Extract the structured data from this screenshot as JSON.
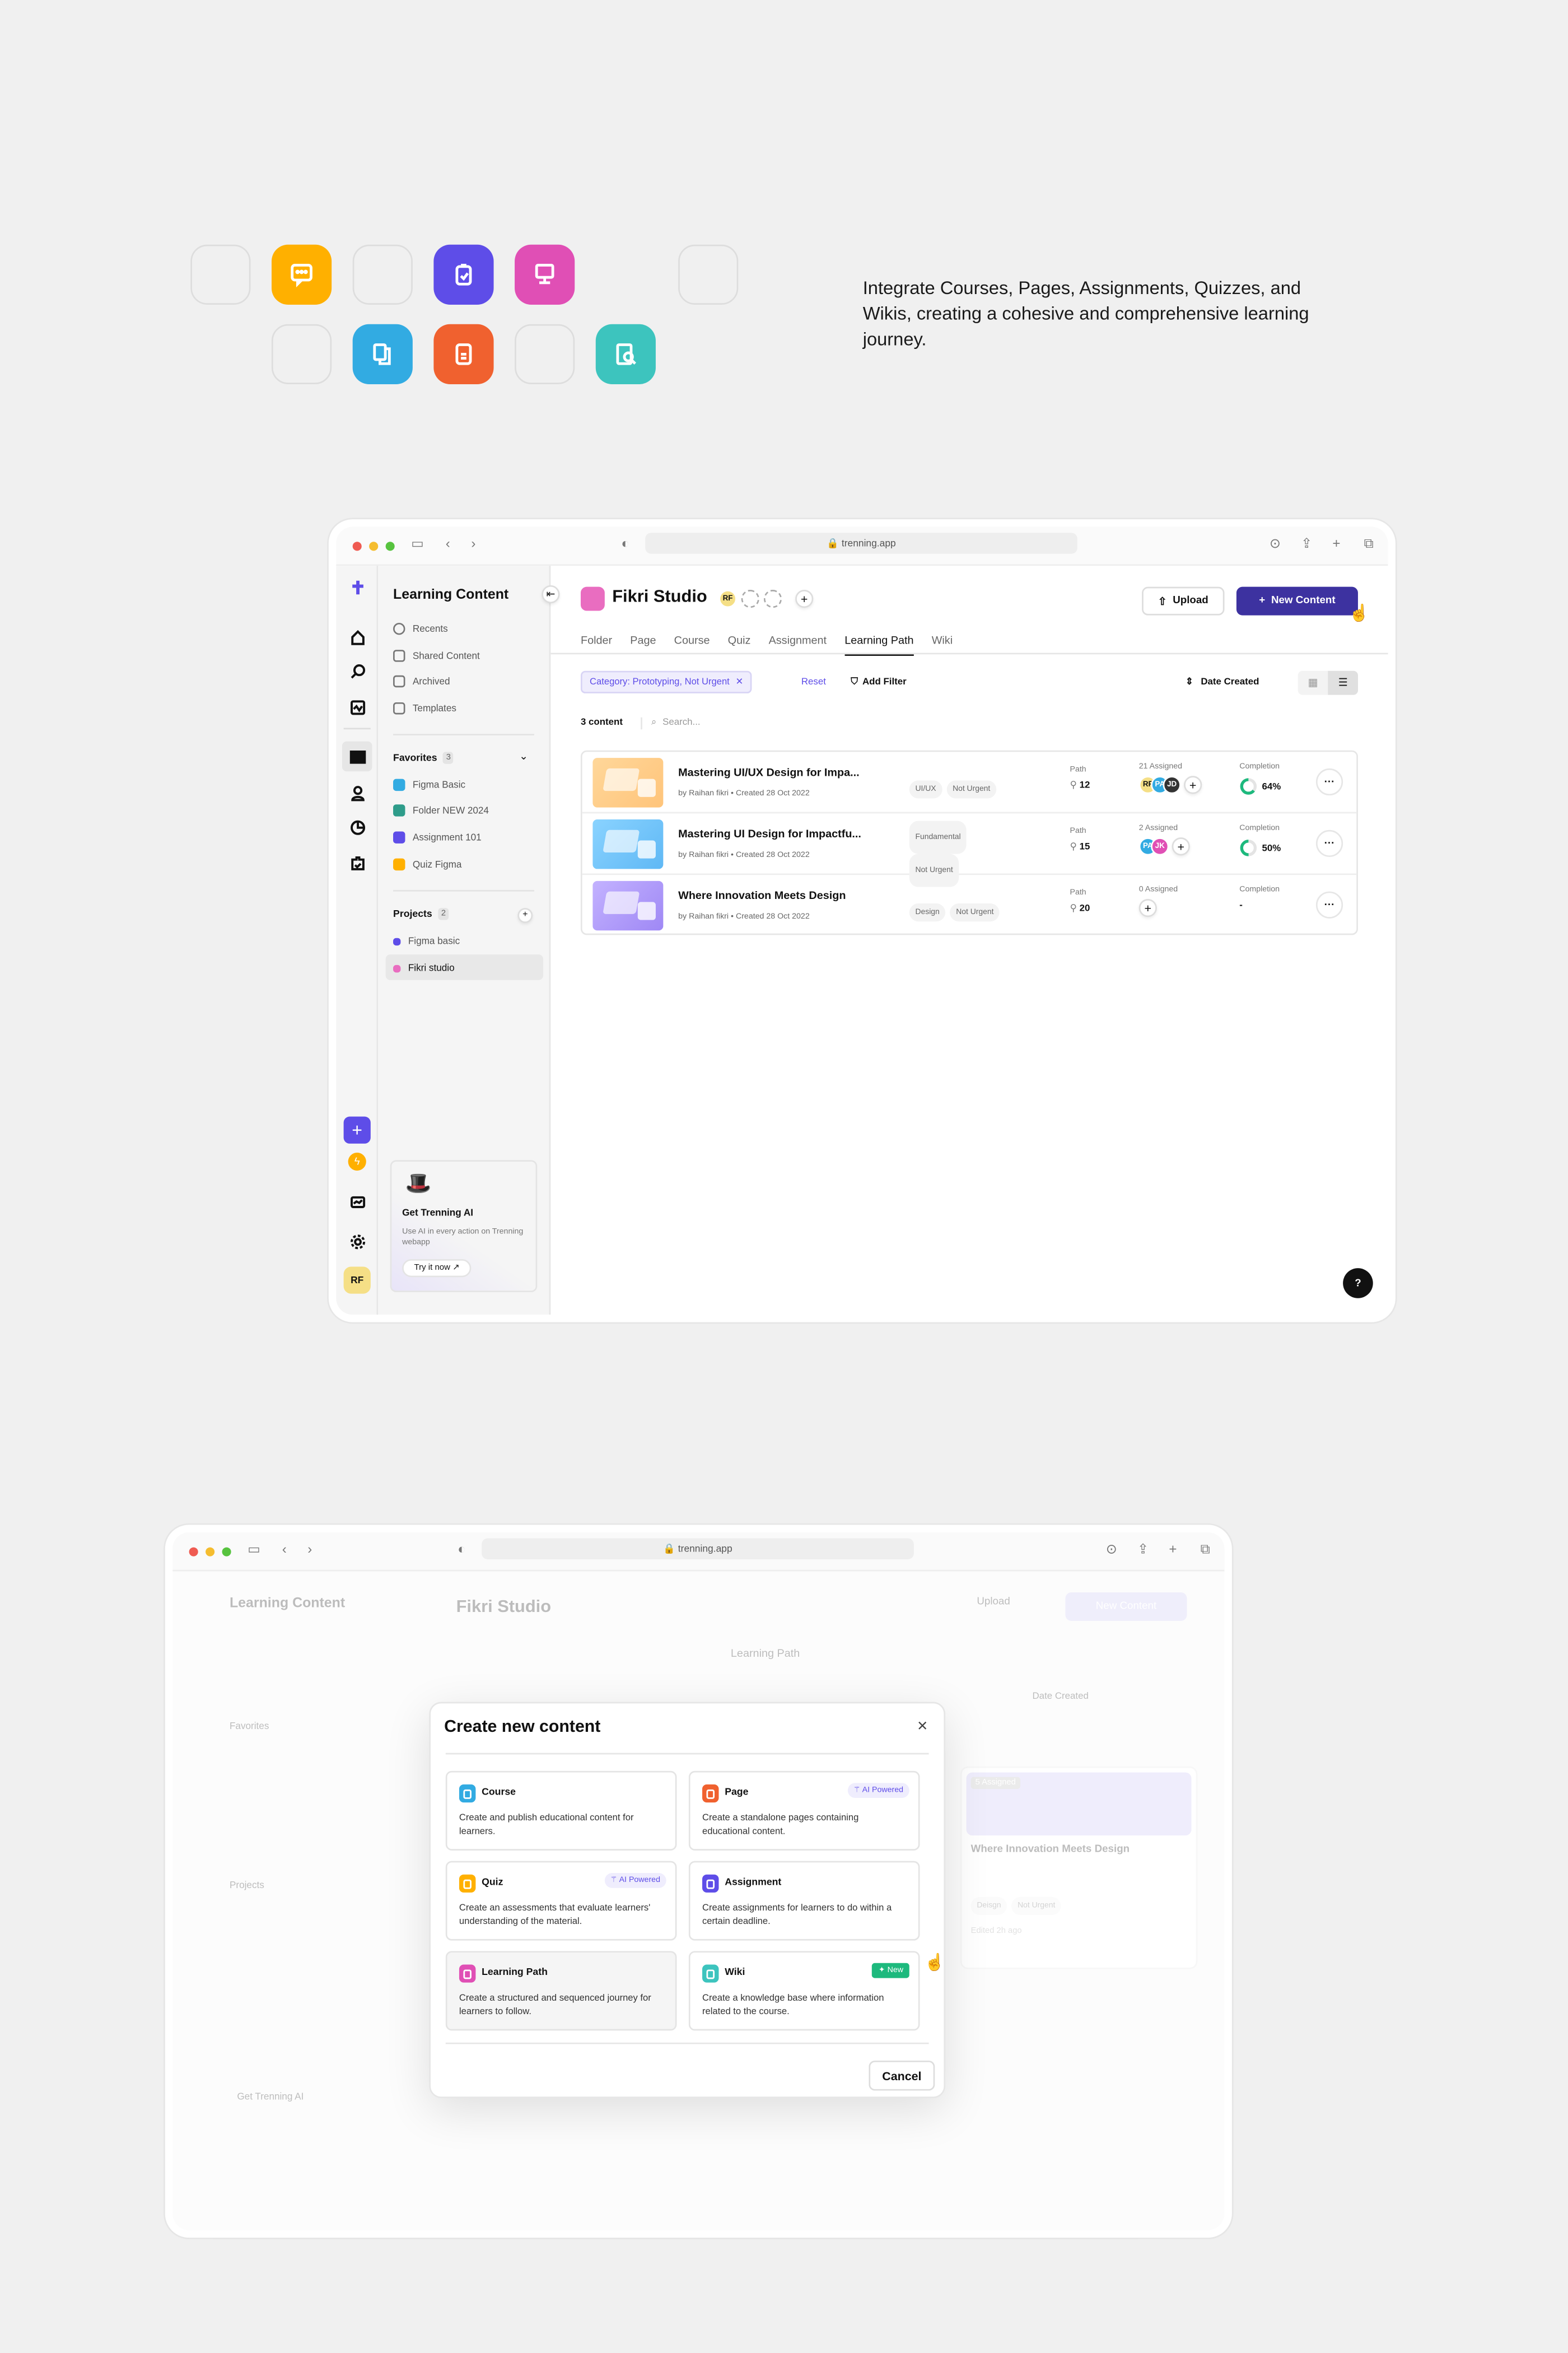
{
  "intro": {
    "text": "Integrate Courses, Pages, Assignments, Quizzes, and Wikis, creating a cohesive and comprehensive learning journey.",
    "tiles": [
      {
        "icon": "quiz-icon",
        "color": "#FFB000"
      },
      {
        "icon": "assignment-icon",
        "color": "#5E4DE8"
      },
      {
        "icon": "learning-path-icon",
        "color": "#E04FB5"
      },
      {
        "icon": "course-icon",
        "color": "#32ABE2"
      },
      {
        "icon": "page-icon",
        "color": "#F0612F"
      },
      {
        "icon": "wiki-icon",
        "color": "#3DC4BE"
      }
    ]
  },
  "browser": {
    "url": "trenning.app"
  },
  "sidebar": {
    "title": "Learning Content",
    "nav": [
      {
        "label": "Recents",
        "icon": "clock-icon"
      },
      {
        "label": "Shared Content",
        "icon": "shared-icon"
      },
      {
        "label": "Archived",
        "icon": "archive-icon"
      },
      {
        "label": "Templates",
        "icon": "templates-icon"
      }
    ],
    "favorites_label": "Favorites",
    "favorites_count": "3",
    "favorites": [
      {
        "label": "Figma Basic",
        "color": "#32ABE2"
      },
      {
        "label": "Folder NEW 2024",
        "color": "#2E9C8A"
      },
      {
        "label": "Assignment 101",
        "color": "#5E4DE8"
      },
      {
        "label": "Quiz Figma",
        "color": "#FFB000"
      }
    ],
    "projects_label": "Projects",
    "projects_count": "2",
    "projects": [
      {
        "label": "Figma basic",
        "color": "#5E4DE8"
      },
      {
        "label": "Fikri studio",
        "color": "#E96DC0"
      }
    ],
    "ai_card": {
      "title": "Get Trenning AI",
      "desc": "Use AI in every action on Trenning webapp",
      "cta": "Try it now ↗"
    },
    "user_initials": "RF"
  },
  "header": {
    "workspace": "Fikri Studio",
    "member_initials": "RF",
    "upload_label": "Upload",
    "new_content_label": "New Content",
    "accent": "#3D32A0"
  },
  "tabs": [
    "Folder",
    "Page",
    "Course",
    "Quiz",
    "Assignment",
    "Learning Path",
    "Wiki"
  ],
  "active_tab": "Learning Path",
  "filters": {
    "chip": "Category: Prototyping, Not Urgent",
    "reset": "Reset",
    "add_filter": "Add Filter",
    "sort": "Date Created"
  },
  "list": {
    "count": "3 content",
    "search_placeholder": "Search...",
    "path_label": "Path",
    "completion_label": "Completion",
    "rows": [
      {
        "title": "Mastering UI/UX Design for Impa...",
        "author": "by Raihan fikri",
        "created": "Created 28 Oct 2022",
        "tags": [
          "UI/UX",
          "Not Urgent"
        ],
        "path": "12",
        "assigned": "21 Assigned",
        "avatars": [
          "RF",
          "PA",
          "JD"
        ],
        "completion": 64,
        "completion_text": "64%"
      },
      {
        "title": "Mastering UI Design for Impactfu...",
        "author": "by Raihan fikri",
        "created": "Created 28 Oct 2022",
        "tags": [
          "Fundamental",
          "Not Urgent"
        ],
        "path": "15",
        "assigned": "2 Assigned",
        "avatars": [
          "PA",
          "JK"
        ],
        "completion": 50,
        "completion_text": "50%"
      },
      {
        "title": "Where Innovation Meets Design",
        "author": "by Raihan fikri",
        "created": "Created 28 Oct 2022",
        "tags": [
          "Design",
          "Not Urgent"
        ],
        "path": "20",
        "assigned": "0 Assigned",
        "avatars": [],
        "completion": null,
        "completion_text": "-"
      }
    ]
  },
  "help_label": "?",
  "background_card": {
    "assigned": "5 Assigned",
    "title": "Where Innovation Meets Design",
    "tags": [
      "Deisgn",
      "Not Urgent"
    ],
    "edited": "Edited 2h ago"
  },
  "modal": {
    "title": "Create new content",
    "cancel": "Cancel",
    "options": [
      {
        "name": "Course",
        "desc": "Create and publish educational content for learners.",
        "color": "#32ABE2",
        "badge": ""
      },
      {
        "name": "Page",
        "desc": "Create a standalone pages containing educational content.",
        "color": "#F0612F",
        "badge": "AI Powered"
      },
      {
        "name": "Quiz",
        "desc": "Create an assessments that evaluate learners' understanding of the material.",
        "color": "#FFB000",
        "badge": "AI Powered"
      },
      {
        "name": "Assignment",
        "desc": "Create assignments for learners to do within a certain deadline.",
        "color": "#5E4DE8",
        "badge": ""
      },
      {
        "name": "Learning Path",
        "desc": "Create a structured and sequenced journey for learners to follow.",
        "color": "#E04FB5",
        "badge": ""
      },
      {
        "name": "Wiki",
        "desc": "Create a knowledge base where information related to the course.",
        "color": "#3DC4BE",
        "badge": "New"
      }
    ]
  }
}
